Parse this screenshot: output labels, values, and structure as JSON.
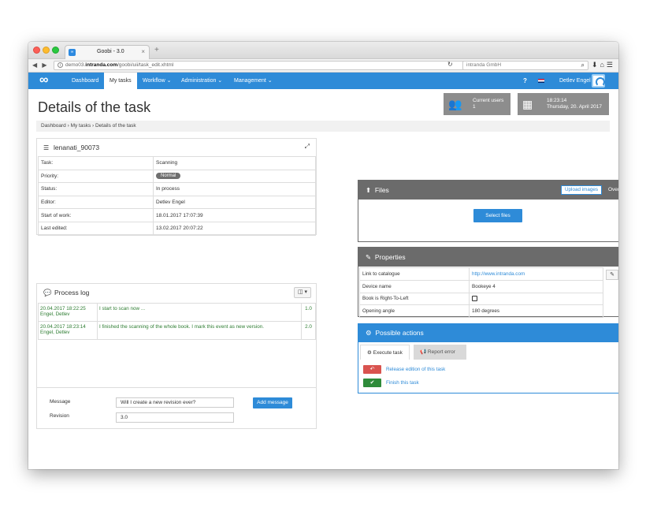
{
  "browser": {
    "tab_title": "Goobi - 3.0",
    "tab_close": "×",
    "new_tab": "+",
    "url_prefix": "demo03.",
    "url_domain": "intranda.com",
    "url_path": "/goobi/uii/task_edit.xhtml",
    "search_text": "intranda GmbH"
  },
  "nav": {
    "items": [
      "Dashboard",
      "My tasks",
      "Workflow",
      "Administration",
      "Management"
    ],
    "help": "?",
    "user": "Detlev Engel"
  },
  "header": {
    "title": "Details of the task",
    "current_users_label": "Current users",
    "current_users_count": "1",
    "time": "18:23:14",
    "date": "Thursday, 20. April 2017"
  },
  "breadcrumb": "Dashboard › My tasks › Details of the task",
  "task": {
    "name": "lenanati_90073",
    "rows": [
      {
        "label": "Task:",
        "value": "Scanning"
      },
      {
        "label": "Priority:",
        "value": "Normal"
      },
      {
        "label": "Status:",
        "value": "In process"
      },
      {
        "label": "Editor:",
        "value": "Detlev Engel"
      },
      {
        "label": "Start of work:",
        "value": "18.01.2017 17:07:39"
      },
      {
        "label": "Last edited:",
        "value": "13.02.2017 20:07:22"
      }
    ]
  },
  "process_log": {
    "title": "Process log",
    "entries": [
      {
        "when": "20.04.2017 18:22:25",
        "who": "Engel, Detlev",
        "text": "I start to scan now ...",
        "rev": "1.0"
      },
      {
        "when": "20.04.2017 18:23:14",
        "who": "Engel, Detlev",
        "text": "I finished the scanning of the whole book. I mark this event as new version.",
        "rev": "2.0"
      }
    ],
    "message_label": "Message",
    "message_value": "Will I create a new revision ever?",
    "revision_label": "Revision",
    "revision_value": "3.0",
    "add_button": "Add message"
  },
  "files": {
    "title": "Files",
    "upload_button": "Upload images",
    "overview": "Overview",
    "select_button": "Select files"
  },
  "properties": {
    "title": "Properties",
    "rows": [
      {
        "label": "Link to catalogue",
        "value": "http://www.intranda.com"
      },
      {
        "label": "Device name",
        "value": "Bookeye 4"
      },
      {
        "label": "Book is Right-To-Left",
        "value": ""
      },
      {
        "label": "Opening angle",
        "value": "180 degrees"
      }
    ]
  },
  "actions": {
    "title": "Possible actions",
    "tab_execute": "Execute task",
    "tab_report": "Report error",
    "release": "Release edition of this task",
    "finish": "Finish this task",
    "release_color": "#d9534f",
    "finish_color": "#2e8b3a"
  },
  "colors": {
    "primary": "#2e8bd8",
    "panel_dark": "#6b6b6b"
  }
}
